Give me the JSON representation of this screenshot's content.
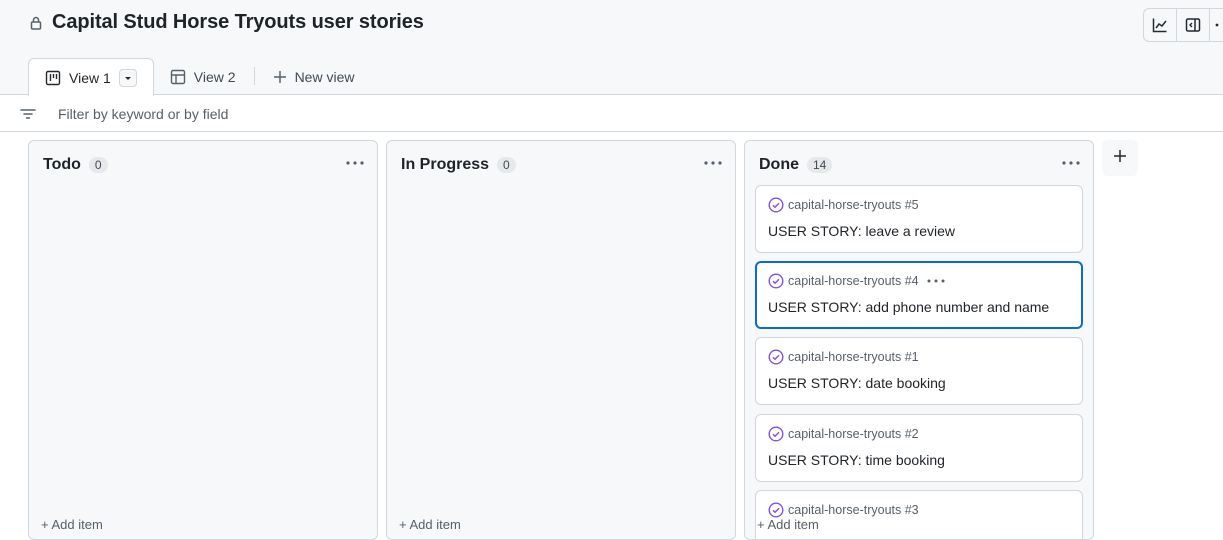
{
  "header": {
    "title": "Capital Stud Horse Tryouts user stories",
    "lock_icon": "lock-icon",
    "actions": [
      {
        "name": "insights-icon"
      },
      {
        "name": "side-panel-icon"
      },
      {
        "name": "more-icon"
      }
    ]
  },
  "tabs": [
    {
      "label": "View 1",
      "icon": "board-icon",
      "active": true
    },
    {
      "label": "View 2",
      "icon": "table-icon",
      "active": false
    },
    {
      "label": "New view",
      "icon": "plus-icon",
      "active": false
    }
  ],
  "filter": {
    "placeholder": "Filter by keyword or by field",
    "icon": "filter-icon"
  },
  "columns": [
    {
      "title": "Todo",
      "count": "0",
      "footer": "+ Add item",
      "cards": []
    },
    {
      "title": "In Progress",
      "count": "0",
      "footer": "+ Add item",
      "cards": []
    },
    {
      "title": "Done",
      "count": "14",
      "footer": "+ Add item",
      "cards": [
        {
          "ref": "capital-horse-tryouts #5",
          "title": "USER STORY: leave a review"
        },
        {
          "ref": "capital-horse-tryouts #4",
          "title": "USER STORY: add phone number and name"
        },
        {
          "ref": "capital-horse-tryouts #1",
          "title": "USER STORY: date booking"
        },
        {
          "ref": "capital-horse-tryouts #2",
          "title": "USER STORY: time booking"
        },
        {
          "ref": "capital-horse-tryouts #3",
          "title": ""
        }
      ]
    }
  ],
  "colors": {
    "accent": "#0969da",
    "done_status": "#8250df",
    "border": "#d0d7de",
    "column_bg": "#f6f8fa"
  }
}
